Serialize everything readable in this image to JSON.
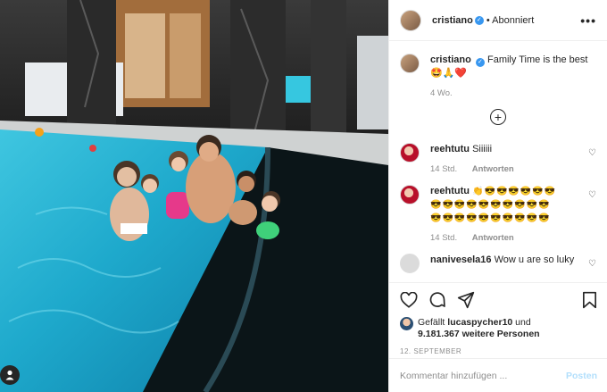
{
  "post": {
    "photo_alt": "",
    "author": "cristiano",
    "follow_label": "Abonniert",
    "more_icon": "more-horizontal-icon",
    "more_glyph": "•••"
  },
  "caption": {
    "username": "cristiano",
    "verified_glyph": "✓",
    "text": "Family Time is the best🤩🙏❤️",
    "age": "4 Wo."
  },
  "load_more_glyph": "+",
  "comments": [
    {
      "username": "reehtutu",
      "text": "Siiiiii",
      "time": "14 Std.",
      "reply": "Antworten"
    },
    {
      "username": "reehtutu",
      "text": "👏😎😎😎😎😎😎\n😎😎😎😎😎😎😎😎😎😎\n😎😎😎😎😎😎😎😎😎😎",
      "time": "14 Std.",
      "reply": "Antworten"
    },
    {
      "username": "nanivesela16",
      "text": "Wow u are so luky"
    }
  ],
  "likes": {
    "prefix": "Gefällt",
    "user": "lucaspycher10",
    "and": "und",
    "count": "9.181.367 weitere Personen"
  },
  "date": "12. September",
  "add_comment": {
    "placeholder": "Kommentar hinzufügen ...",
    "post_label": "Posten"
  },
  "colors": {
    "verified": "#3897f0",
    "post_disabled": "#b2dffc",
    "pool_water": "#1aa9c9"
  }
}
